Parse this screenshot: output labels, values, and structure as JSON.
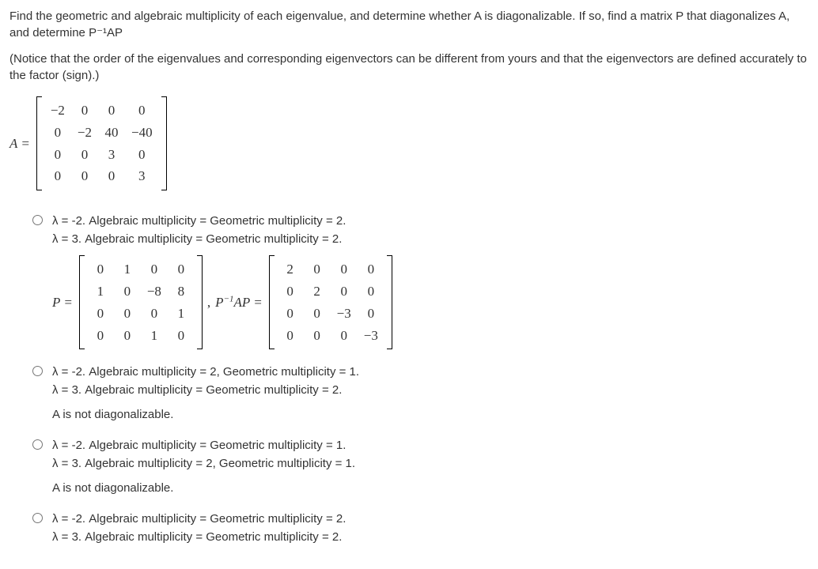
{
  "question": {
    "text1": "Find the geometric and algebraic multiplicity of each eigenvalue, and determine whether A is diagonalizable. If so, find a matrix P that diagonalizes A, and determine P⁻¹AP",
    "text2": "(Notice that the order of the eigenvalues and corresponding eigenvectors can be different from yours and that the eigenvectors are defined accurately to the factor (sign).)"
  },
  "matrix_A": {
    "label": "A =",
    "rows": [
      [
        "−2",
        "0",
        "0",
        "0"
      ],
      [
        "0",
        "−2",
        "40",
        "−40"
      ],
      [
        "0",
        "0",
        "3",
        "0"
      ],
      [
        "0",
        "0",
        "0",
        "3"
      ]
    ]
  },
  "options": [
    {
      "line1": "λ = -2. Algebraic multiplicity = Geometric multiplicity = 2.",
      "line2": "λ = 3. Algebraic multiplicity = Geometric multiplicity = 2.",
      "has_matrices": true,
      "P_label": "P =",
      "P_rows": [
        [
          "0",
          "1",
          "0",
          "0"
        ],
        [
          "1",
          "0",
          "−8",
          "8"
        ],
        [
          "0",
          "0",
          "0",
          "1"
        ],
        [
          "0",
          "0",
          "1",
          "0"
        ]
      ],
      "PAP_label_pre": "P",
      "PAP_label_sup": "−1",
      "PAP_label_post": "AP =",
      "PAP_rows": [
        [
          "2",
          "0",
          "0",
          "0"
        ],
        [
          "0",
          "2",
          "0",
          "0"
        ],
        [
          "0",
          "0",
          "−3",
          "0"
        ],
        [
          "0",
          "0",
          "0",
          "−3"
        ]
      ]
    },
    {
      "line1": "λ = -2. Algebraic multiplicity = 2, Geometric multiplicity = 1.",
      "line2": "λ = 3. Algebraic multiplicity = Geometric multiplicity = 2.",
      "not_diag": "A is not diagonalizable."
    },
    {
      "line1": "λ = -2. Algebraic multiplicity = Geometric multiplicity = 1.",
      "line2": "λ = 3. Algebraic multiplicity = 2, Geometric multiplicity = 1.",
      "not_diag": "A is not diagonalizable."
    },
    {
      "line1": "λ = -2. Algebraic multiplicity = Geometric multiplicity = 2.",
      "line2": "λ = 3. Algebraic multiplicity = Geometric multiplicity = 2."
    }
  ],
  "comma": ","
}
